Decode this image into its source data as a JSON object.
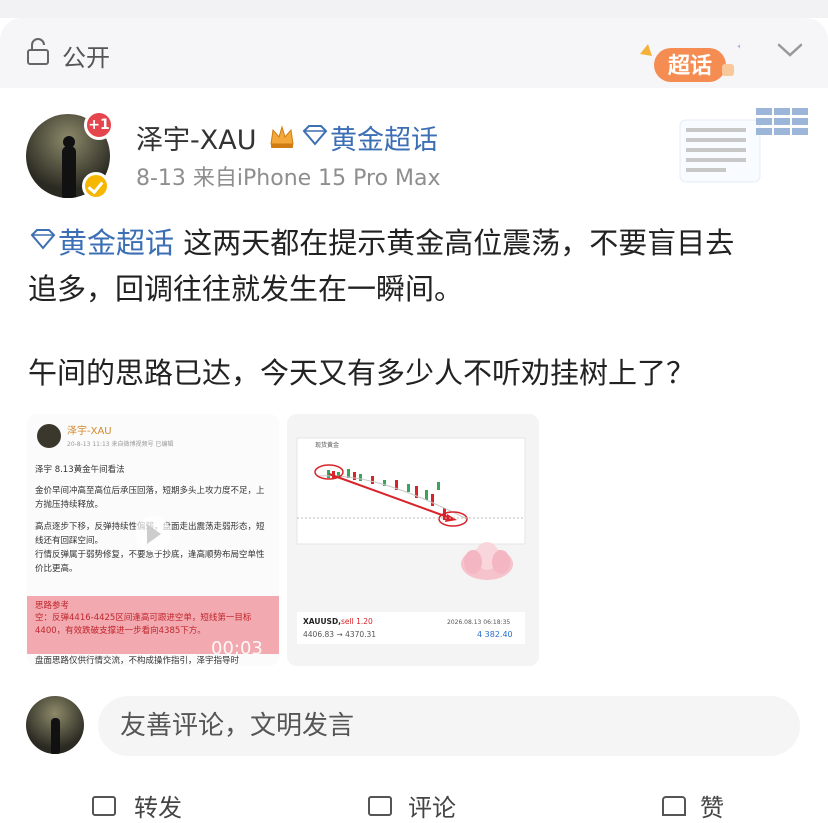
{
  "visibility": {
    "label": "公开",
    "icon": "lock-icon"
  },
  "badge": {
    "label": "超话",
    "icon": "chaohua-badge-icon"
  },
  "post": {
    "author": "泽宇-XAU",
    "header_topic": "黄金超话",
    "notification_count": "+1",
    "meta": "8-13  来自iPhone 15 Pro Max",
    "topic_tag": "黄金超话",
    "line1_rest": " 这两天都在提示黄金高位震荡，不要盲目去",
    "line2": "追多，回调往往就发生在一瞬间。",
    "line3": "午间的思路已达，今天又有多少人不听劝挂树上了？"
  },
  "image1": {
    "author": "泽宇-XAU",
    "meta": "20-8-13 11:13 来自微博视频号 已编辑",
    "title": "泽宇 8.13黄金午间看法",
    "para1": "金价早间冲高至高位后承压回落，短期多头上攻力度不足，上方抛压持续释放。",
    "para2": "高点逐步下移，反弹持续性偏弱，盘面走出震荡走弱形态，短线还有回踩空间。",
    "para3": "行情反弹属于弱势修复，不要急于抄底，逢高顺势布局空单性价比更高。",
    "box_title": "思路参考",
    "box_text": "空：反弹4416-4425区间逢高可跟进空单，短线第一目标4400，有效跌破支撑进一步看向4385下方。",
    "footer": "盘面思路仅供行情交流，不构成操作指引，泽宇指导时",
    "duration": "00:03"
  },
  "image2": {
    "header": "现货黄金",
    "symbol": "XAUUSD,",
    "action": "sell 1.20",
    "datetime": "2026.08.13 06:18:35",
    "prices": "4406.83 → 4370.31",
    "profit": "4 382.40"
  },
  "comment": {
    "placeholder": "友善评论，文明发言"
  },
  "actions": {
    "repost": "转发",
    "comment": "评论",
    "like": "赞"
  },
  "colors": {
    "topic": "#3c6fb4",
    "badge_red": "#e5454d",
    "accent_gold": "#f6b700",
    "sell_red": "#d8232a"
  }
}
